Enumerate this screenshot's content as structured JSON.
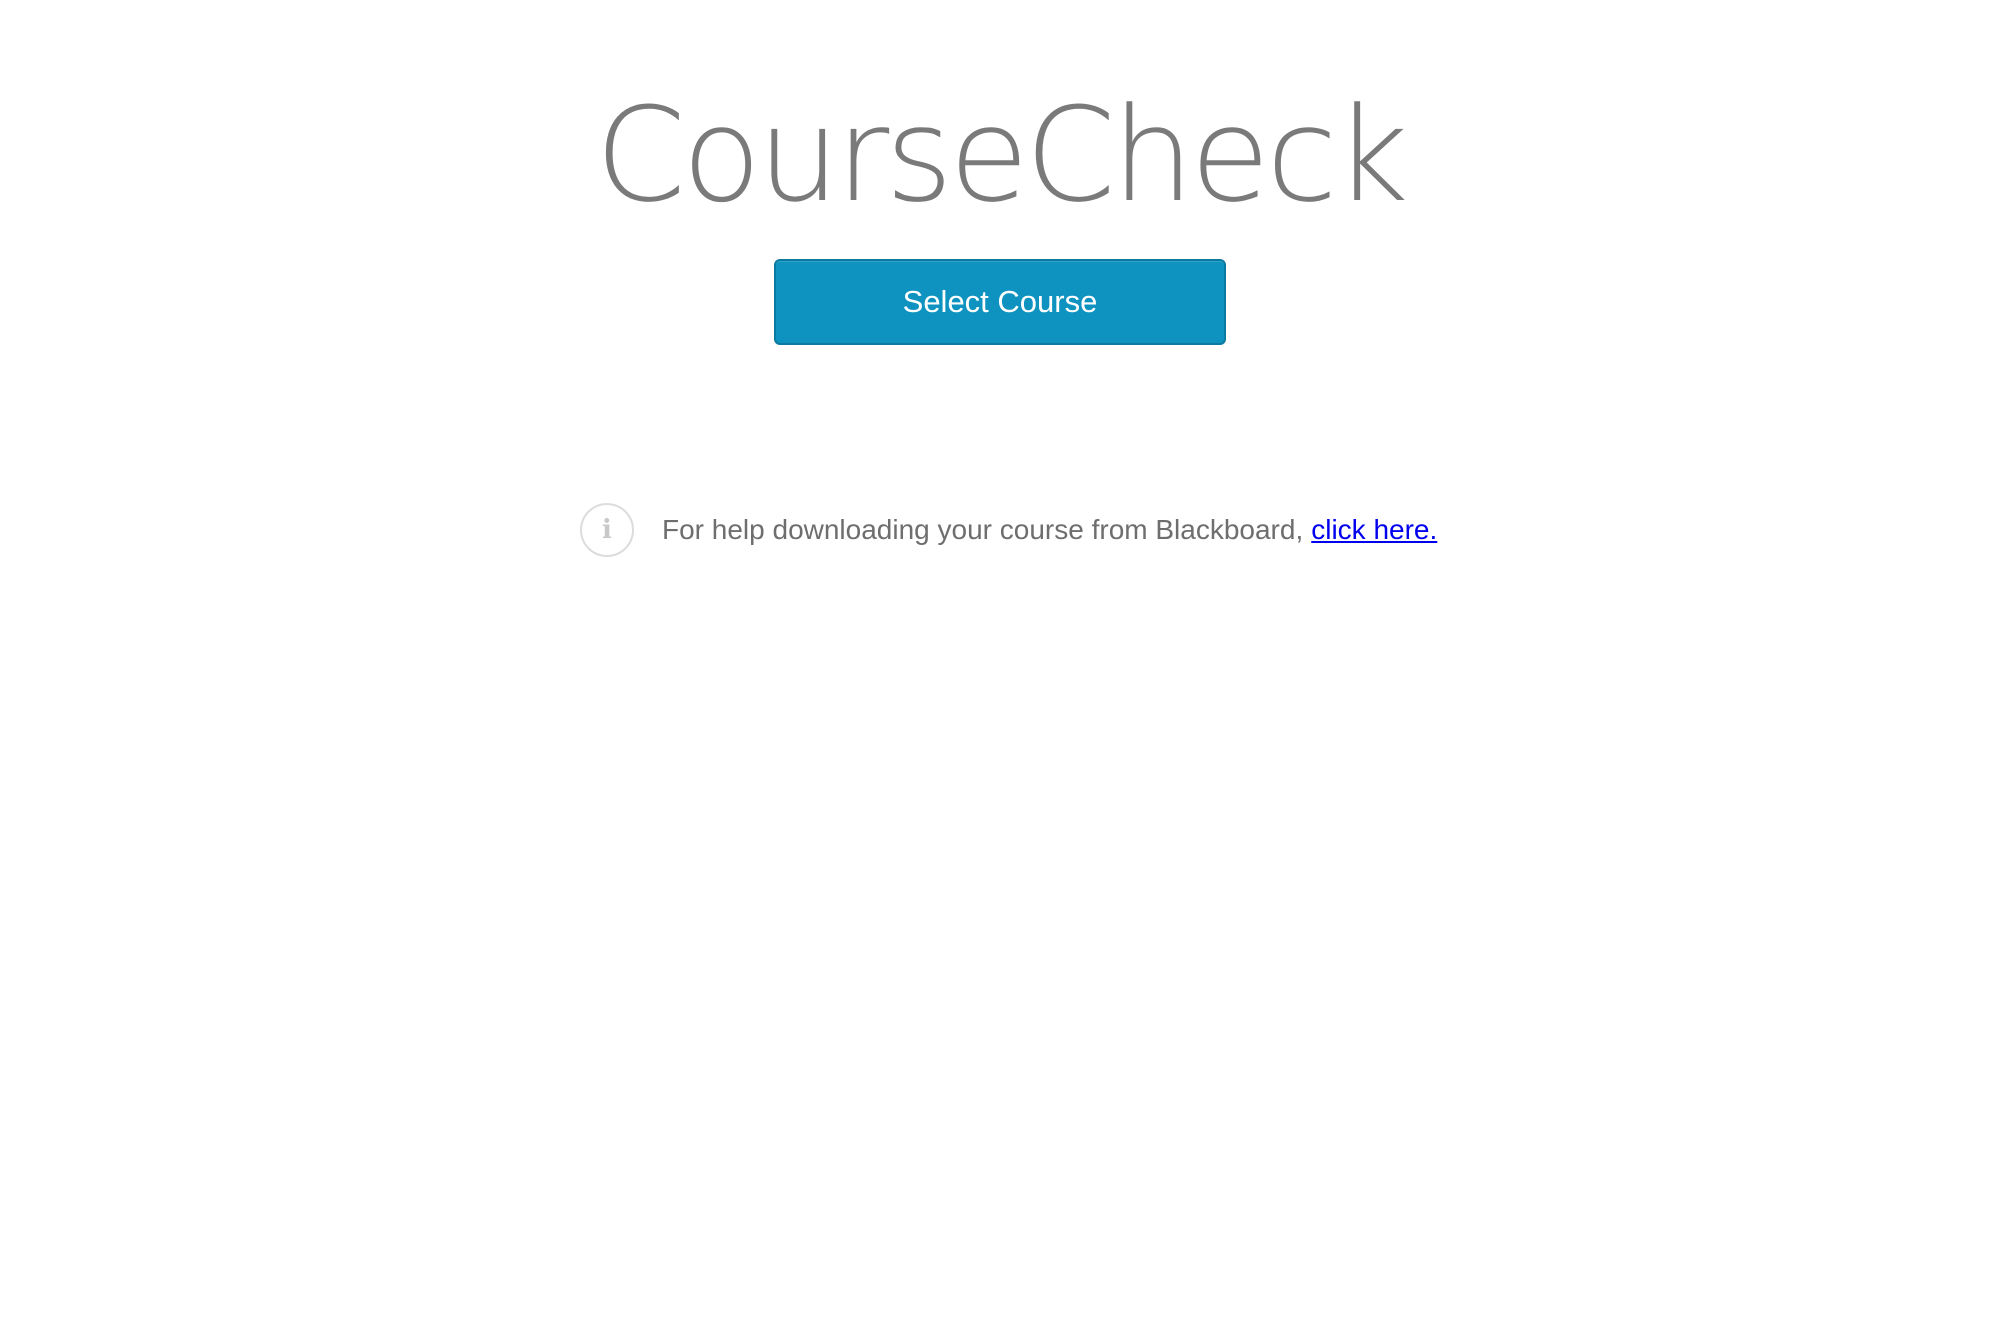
{
  "app": {
    "title": "CourseCheck"
  },
  "actions": {
    "select_course_label": "Select Course"
  },
  "help": {
    "icon": "info-icon",
    "icon_glyph": "i",
    "text": "For help downloading your course from Blackboard,",
    "link_text": "click here."
  },
  "colors": {
    "button_bg": "#0e93c0",
    "title_text": "#7a7a7a",
    "link": "#0000ee"
  }
}
